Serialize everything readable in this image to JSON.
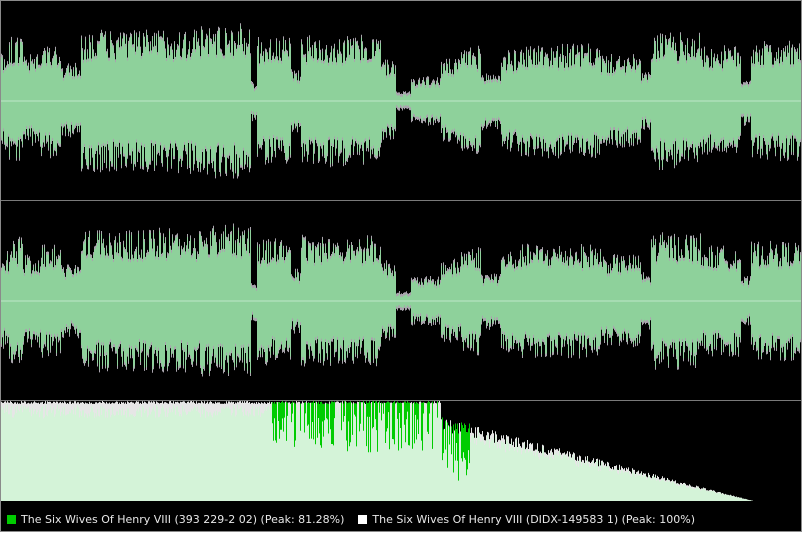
{
  "colors": {
    "background": "#000000",
    "source_a": "#00cc00",
    "source_a_fill": "#8ed19b",
    "source_b": "#ffffff",
    "source_b_outline": "#a9a4ad",
    "center_line": "#bfe8c8",
    "divider": "#7a7a7a"
  },
  "legend": {
    "items": [
      {
        "label": "The Six Wives Of Henry VIII (393 229-2 02) (Peak: 81.28%)",
        "color": "#00cc00"
      },
      {
        "label": "The Six Wives Of Henry VIII (DIDX-149583 1) (Peak: 100%)",
        "color": "#ffffff"
      }
    ]
  },
  "icons": {
    "legend_a": "green-square-icon",
    "legend_b": "white-square-icon"
  }
}
